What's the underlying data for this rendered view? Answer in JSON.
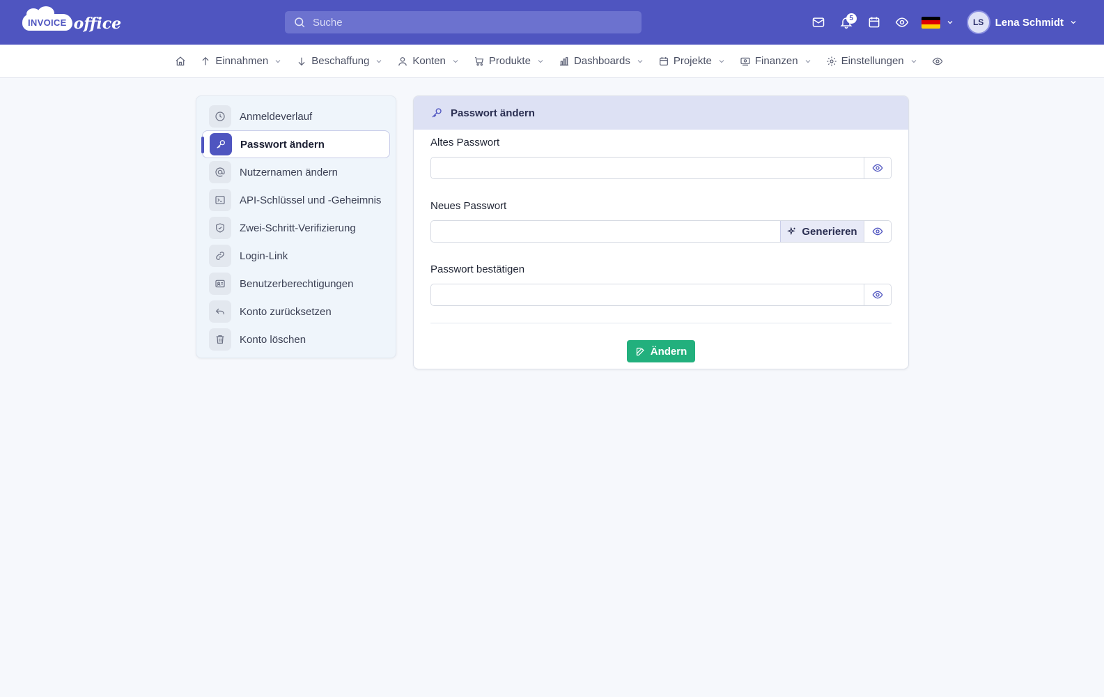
{
  "logo": {
    "brand_a": "INVOICE",
    "brand_b": "office"
  },
  "search": {
    "placeholder": "Suche"
  },
  "notifications": {
    "count": "5"
  },
  "user": {
    "initials": "LS",
    "name": "Lena Schmidt"
  },
  "flag_colors": [
    "#000000",
    "#dd0000",
    "#ffce00"
  ],
  "nav": {
    "items": [
      {
        "label": "Einnahmen",
        "icon": "arrow-up-icon"
      },
      {
        "label": "Beschaffung",
        "icon": "arrow-down-icon"
      },
      {
        "label": "Konten",
        "icon": "user-icon"
      },
      {
        "label": "Produkte",
        "icon": "cart-icon"
      },
      {
        "label": "Dashboards",
        "icon": "bar-chart-icon"
      },
      {
        "label": "Projekte",
        "icon": "calendar-icon"
      },
      {
        "label": "Finanzen",
        "icon": "money-icon"
      },
      {
        "label": "Einstellungen",
        "icon": "gear-icon"
      }
    ]
  },
  "sidebar": {
    "items": [
      {
        "label": "Anmeldeverlauf",
        "icon": "clock-icon"
      },
      {
        "label": "Passwort ändern",
        "icon": "key-icon",
        "active": true
      },
      {
        "label": "Nutzernamen ändern",
        "icon": "at-icon"
      },
      {
        "label": "API-Schlüssel und -Geheimnis",
        "icon": "terminal-icon"
      },
      {
        "label": "Zwei-Schritt-Verifizierung",
        "icon": "shield-icon"
      },
      {
        "label": "Login-Link",
        "icon": "link-icon"
      },
      {
        "label": "Benutzerberechtigungen",
        "icon": "id-card-icon"
      },
      {
        "label": "Konto zurücksetzen",
        "icon": "undo-icon"
      },
      {
        "label": "Konto löschen",
        "icon": "trash-icon"
      }
    ]
  },
  "panel": {
    "title": "Passwort ändern",
    "old_label": "Altes Passwort",
    "new_label": "Neues Passwort",
    "generate_label": "Generieren",
    "confirm_label": "Passwort bestätigen",
    "submit_label": "Ändern"
  },
  "colors": {
    "brand": "#4f55c0",
    "success": "#22b07d"
  }
}
